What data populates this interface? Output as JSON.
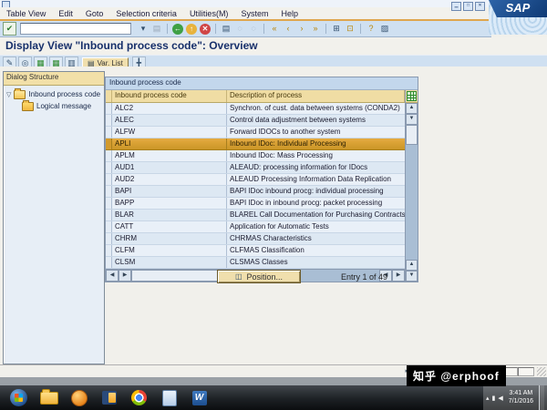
{
  "window": {
    "menu_items": [
      "Table View",
      "Edit",
      "Goto",
      "Selection criteria",
      "Utilities(M)",
      "System",
      "Help"
    ],
    "controls": [
      {
        "name": "minimize-button",
        "glyph": "▁"
      },
      {
        "name": "maximize-button",
        "glyph": "□"
      },
      {
        "name": "close-button",
        "glyph": "✕"
      }
    ],
    "logo_text": "SAP",
    "screen_title": "Display View \"Inbound process code\": Overview"
  },
  "std_toolbar": {
    "enter_glyph": "✔",
    "command_value": "",
    "icons": [
      {
        "name": "dropdown-icon",
        "glyph": "▾",
        "fg": "#33506e"
      },
      {
        "name": "save-icon",
        "glyph": "▤",
        "type": "disabled"
      },
      {
        "type": "divider"
      },
      {
        "name": "back-icon",
        "glyph": "←",
        "bg": "#3fa045",
        "type": "circ"
      },
      {
        "name": "exit-icon",
        "glyph": "↑",
        "bg": "#e8b33c",
        "type": "circ"
      },
      {
        "name": "cancel-icon",
        "glyph": "✕",
        "bg": "#d04545",
        "type": "circ"
      },
      {
        "type": "divider"
      },
      {
        "name": "print-icon",
        "glyph": "▤",
        "fg": "#33506e"
      },
      {
        "name": "find-icon",
        "glyph": "◌",
        "type": "disabled"
      },
      {
        "name": "find-next-icon",
        "glyph": "◌",
        "type": "disabled"
      },
      {
        "type": "divider"
      },
      {
        "name": "first-page-icon",
        "glyph": "«",
        "fg": "#b8860b"
      },
      {
        "name": "previous-page-icon",
        "glyph": "‹",
        "fg": "#b8860b"
      },
      {
        "name": "next-page-icon",
        "glyph": "›",
        "fg": "#b8860b"
      },
      {
        "name": "last-page-icon",
        "glyph": "»",
        "fg": "#b8860b"
      },
      {
        "type": "divider"
      },
      {
        "name": "new-session-icon",
        "glyph": "⊞",
        "fg": "#33506e"
      },
      {
        "name": "shortcut-icon",
        "glyph": "⊡",
        "fg": "#b8860b"
      },
      {
        "type": "divider"
      },
      {
        "name": "help-icon",
        "glyph": "?",
        "fg": "#b8860b"
      },
      {
        "name": "customize-icon",
        "glyph": "▨",
        "fg": "#33506e"
      }
    ]
  },
  "app_toolbar": {
    "icons": [
      {
        "name": "display-change-icon",
        "glyph": "✎",
        "fg": "#33506e"
      },
      {
        "name": "choose-icon",
        "glyph": "◎",
        "fg": "#33506e"
      },
      {
        "name": "new-entries-icon",
        "glyph": "▦",
        "fg": "#2d8a2d"
      },
      {
        "name": "copy-entries-icon",
        "glyph": "▦",
        "fg": "#2d8a2d"
      },
      {
        "name": "undo-change-icon",
        "glyph": "▥",
        "fg": "#33506e"
      }
    ],
    "var_list_label": "Var. List",
    "var_list_icon_glyph": "▤",
    "config_icon_glyph": "╋"
  },
  "dialog_structure": {
    "title": "Dialog Structure",
    "items": [
      {
        "label": "Inbound process code",
        "expanded": true
      },
      {
        "label": "Logical message",
        "expanded": false
      }
    ]
  },
  "table": {
    "caption": "Inbound process code",
    "columns": [
      "Inbound process code",
      "Description of process"
    ],
    "rows": [
      {
        "code": "ALC2",
        "desc": "Synchron. of cust. data between systems (CONDA2)"
      },
      {
        "code": "ALEC",
        "desc": "Control data adjustment between systems"
      },
      {
        "code": "ALFW",
        "desc": "Forward IDOCs to another system"
      },
      {
        "code": "APLI",
        "desc": "Inbound IDoc: Individual Processing",
        "selected": true
      },
      {
        "code": "APLM",
        "desc": "Inbound IDoc: Mass Processing"
      },
      {
        "code": "AUD1",
        "desc": "ALEAUD: processing information for IDocs"
      },
      {
        "code": "AUD2",
        "desc": "ALEAUD Processing Information Data Replication"
      },
      {
        "code": "BAPI",
        "desc": "BAPI IDoc inbound procg: individual processing"
      },
      {
        "code": "BAPP",
        "desc": "BAPI IDoc in inbound procg: packet processing"
      },
      {
        "code": "BLAR",
        "desc": "BLAREL Call Documentation for Purchasing Contracts"
      },
      {
        "code": "CATT",
        "desc": "Application for Automatic Tests"
      },
      {
        "code": "CHRM",
        "desc": "CHRMAS Characteristics"
      },
      {
        "code": "CLFM",
        "desc": "CLFMAS Classification"
      },
      {
        "code": "CLSM",
        "desc": "CLSMAS Classes"
      }
    ],
    "scroll_glyphs": {
      "up": "▲",
      "down": "▼",
      "left": "◀",
      "right": "▶"
    }
  },
  "footer": {
    "position_label": "Position...",
    "position_icon_glyph": "◫",
    "entry_info": "Entry 1 of 49"
  },
  "statusbar": {
    "arrow_glyph": "▸"
  },
  "taskbar": {
    "apps": [
      {
        "name": "start-button"
      },
      {
        "name": "explorer-icon"
      },
      {
        "name": "sap-logon-icon"
      },
      {
        "name": "notes-icon"
      },
      {
        "name": "chrome-icon"
      },
      {
        "name": "notepad-icon"
      },
      {
        "name": "word-icon",
        "glyph": "W"
      }
    ],
    "tray_icons": [
      {
        "name": "tray-expand-icon",
        "glyph": "▴"
      },
      {
        "name": "network-icon",
        "glyph": "▮"
      },
      {
        "name": "volume-icon",
        "glyph": "◀"
      }
    ],
    "time": "3:41 AM",
    "date": "7/1/2016"
  },
  "watermark": "知乎 @erphoof"
}
